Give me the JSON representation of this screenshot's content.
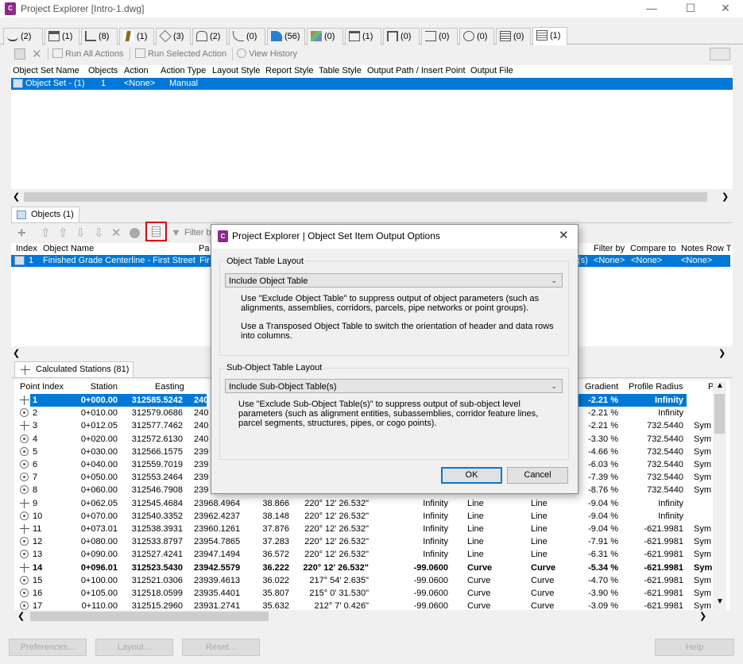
{
  "window": {
    "title": "Project Explorer [Intro-1.dwg]",
    "app_icon_letter": "C"
  },
  "tabs": [
    {
      "count": "(2)",
      "icon": "alignment-icon"
    },
    {
      "count": "(1)",
      "icon": "assembly-icon"
    },
    {
      "count": "(8)",
      "icon": "corridor-icon"
    },
    {
      "count": "(1)",
      "icon": "road-icon"
    },
    {
      "count": "(3)",
      "icon": "intersection-icon"
    },
    {
      "count": "(2)",
      "icon": "parcel-icon"
    },
    {
      "count": "(0)",
      "icon": "feature-line-icon"
    },
    {
      "count": "(56)",
      "icon": "profile-icon"
    },
    {
      "count": "(0)",
      "icon": "surface-icon"
    },
    {
      "count": "(1)",
      "icon": "pipe-network-icon"
    },
    {
      "count": "(0)",
      "icon": "pressure-network-icon"
    },
    {
      "count": "(0)",
      "icon": "section-view-icon"
    },
    {
      "count": "(0)",
      "icon": "point-group-icon"
    },
    {
      "count": "(0)",
      "icon": "table-icon"
    },
    {
      "count": "(1)",
      "icon": "object-set-icon"
    }
  ],
  "action_toolbar": {
    "run_all": "Run All Actions",
    "run_selected": "Run Selected Action",
    "view_history": "View History"
  },
  "object_sets": {
    "columns": [
      "Object Set Name",
      "Objects",
      "Action",
      "Action Type",
      "Layout Style",
      "Report Style",
      "Table Style",
      "Output Path / Insert Point",
      "Output File"
    ],
    "rows": [
      {
        "name": "Object Set - (1)",
        "objects": "1",
        "action": "<None>",
        "action_type": "Manual"
      }
    ]
  },
  "objects_tab": {
    "label": "Objects (1)",
    "filter_placeholder": "Filter b"
  },
  "objects_grid": {
    "columns": [
      "Index",
      "Object Name",
      "Pa",
      "Filter by",
      "Compare to",
      "Notes Row T"
    ],
    "rows": [
      {
        "index": "1",
        "name": "Finished Grade Centerline - First Street",
        "pa": "Fir",
        "frag": "(s)",
        "filter_by": "<None>",
        "compare_to": "<None>",
        "notes": "<None>"
      }
    ]
  },
  "stations_tab": {
    "label": "Calculated Stations (81)"
  },
  "stations_grid": {
    "columns": [
      "Point Index",
      "Station",
      "Easting",
      "Gradient",
      "Profile Radius",
      "P"
    ],
    "rows": [
      {
        "idx": "1",
        "sta": "0+000.00",
        "e": "312585.5242",
        "n": "240",
        "g": "-2.21 %",
        "pr": "Infinity",
        "s": "",
        "selected": true,
        "bold": true,
        "icon": "cross"
      },
      {
        "idx": "2",
        "sta": "0+010.00",
        "e": "312579.0686",
        "n": "240",
        "g": "-2.21 %",
        "pr": "Infinity",
        "s": "",
        "icon": "circle"
      },
      {
        "idx": "3",
        "sta": "0+012.05",
        "e": "312577.7462",
        "n": "240",
        "g": "-2.21 %",
        "pr": "732.5440",
        "s": "Sym",
        "icon": "cross"
      },
      {
        "idx": "4",
        "sta": "0+020.00",
        "e": "312572.6130",
        "n": "240",
        "g": "-3.30 %",
        "pr": "732.5440",
        "s": "Sym",
        "icon": "circle"
      },
      {
        "idx": "5",
        "sta": "0+030.00",
        "e": "312566.1575",
        "n": "239",
        "g": "-4.66 %",
        "pr": "732.5440",
        "s": "Sym",
        "icon": "circle"
      },
      {
        "idx": "6",
        "sta": "0+040.00",
        "e": "312559.7019",
        "n": "239",
        "g": "-6.03 %",
        "pr": "732.5440",
        "s": "Sym",
        "icon": "circle"
      },
      {
        "idx": "7",
        "sta": "0+050.00",
        "e": "312553.2464",
        "n": "239",
        "g": "-7.39 %",
        "pr": "732.5440",
        "s": "Sym",
        "icon": "circle"
      },
      {
        "idx": "8",
        "sta": "0+060.00",
        "e": "312546.7908",
        "n": "239",
        "g": "-8.76 %",
        "pr": "732.5440",
        "s": "Sym",
        "icon": "circle"
      },
      {
        "idx": "9",
        "sta": "0+062.05",
        "e": "312545.4684",
        "n": "23968.4964",
        "d": "38.866",
        "b": "220° 12' 26.532\"",
        "rad": "Infinity",
        "t1": "Line",
        "t2": "Line",
        "g": "-9.04 %",
        "pr": "Infinity",
        "s": "",
        "icon": "cross"
      },
      {
        "idx": "10",
        "sta": "0+070.00",
        "e": "312540.3352",
        "n": "23962.4237",
        "d": "38.148",
        "b": "220° 12' 26.532\"",
        "rad": "Infinity",
        "t1": "Line",
        "t2": "Line",
        "g": "-9.04 %",
        "pr": "Infinity",
        "s": "",
        "icon": "circle"
      },
      {
        "idx": "11",
        "sta": "0+073.01",
        "e": "312538.3931",
        "n": "23960.1261",
        "d": "37.876",
        "b": "220° 12' 26.532\"",
        "rad": "Infinity",
        "t1": "Line",
        "t2": "Line",
        "g": "-9.04 %",
        "pr": "-621.9981",
        "s": "Sym",
        "icon": "cross"
      },
      {
        "idx": "12",
        "sta": "0+080.00",
        "e": "312533.8797",
        "n": "23954.7865",
        "d": "37.283",
        "b": "220° 12' 26.532\"",
        "rad": "Infinity",
        "t1": "Line",
        "t2": "Line",
        "g": "-7.91 %",
        "pr": "-621.9981",
        "s": "Sym",
        "icon": "circle"
      },
      {
        "idx": "13",
        "sta": "0+090.00",
        "e": "312527.4241",
        "n": "23947.1494",
        "d": "36.572",
        "b": "220° 12' 26.532\"",
        "rad": "Infinity",
        "t1": "Line",
        "t2": "Line",
        "g": "-6.31 %",
        "pr": "-621.9981",
        "s": "Sym",
        "icon": "circle"
      },
      {
        "idx": "14",
        "sta": "0+096.01",
        "e": "312523.5430",
        "n": "23942.5579",
        "d": "36.222",
        "b": "220° 12' 26.532\"",
        "rad": "-99.0600",
        "t1": "Curve",
        "t2": "Curve",
        "g": "-5.34 %",
        "pr": "-621.9981",
        "s": "Sym",
        "bold": true,
        "icon": "cross"
      },
      {
        "idx": "15",
        "sta": "0+100.00",
        "e": "312521.0306",
        "n": "23939.4613",
        "d": "36.022",
        "b": "217° 54' 2.635\"",
        "rad": "-99.0600",
        "t1": "Curve",
        "t2": "Curve",
        "g": "-4.70 %",
        "pr": "-621.9981",
        "s": "Sym",
        "icon": "circle"
      },
      {
        "idx": "16",
        "sta": "0+105.00",
        "e": "312518.0599",
        "n": "23935.4401",
        "d": "35.807",
        "b": "215° 0' 31.530\"",
        "rad": "-99.0600",
        "t1": "Curve",
        "t2": "Curve",
        "g": "-3.90 %",
        "pr": "-621.9981",
        "s": "Sym",
        "icon": "circle"
      },
      {
        "idx": "17",
        "sta": "0+110.00",
        "e": "312515.2960",
        "n": "23931.2741",
        "d": "35.632",
        "b": "212° 7' 0.426\"",
        "rad": "-99.0600",
        "t1": "Curve",
        "t2": "Curve",
        "g": "-3.09 %",
        "pr": "-621.9981",
        "s": "Sym",
        "icon": "circle"
      }
    ]
  },
  "bottom_buttons": {
    "preferences": "Preferences...",
    "layout": "Layout...",
    "reset": "Reset...",
    "help": "Help"
  },
  "dialog": {
    "title": "Project Explorer | Object Set Item Output Options",
    "group1": {
      "label": "Object Table Layout",
      "value": "Include Object Table",
      "text1": "Use \"Exclude Object Table\" to suppress output of object parameters (such as alignments, assemblies, corridors, parcels, pipe networks or point groups).",
      "text2": "Use a Transposed Object Table to switch the orientation of header and data rows into columns."
    },
    "group2": {
      "label": "Sub-Object Table Layout",
      "value": "Include Sub-Object Table(s)",
      "text1": "Use \"Exclude Sub-Object Table(s)\" to suppress output of sub-object level parameters (such as alignment entities, subassemblies, corridor feature lines, parcel segments, structures, pipes, or cogo points)."
    },
    "ok": "OK",
    "cancel": "Cancel"
  },
  "colors": {
    "selection": "#0078d7",
    "highlight_box": "#e00000"
  }
}
